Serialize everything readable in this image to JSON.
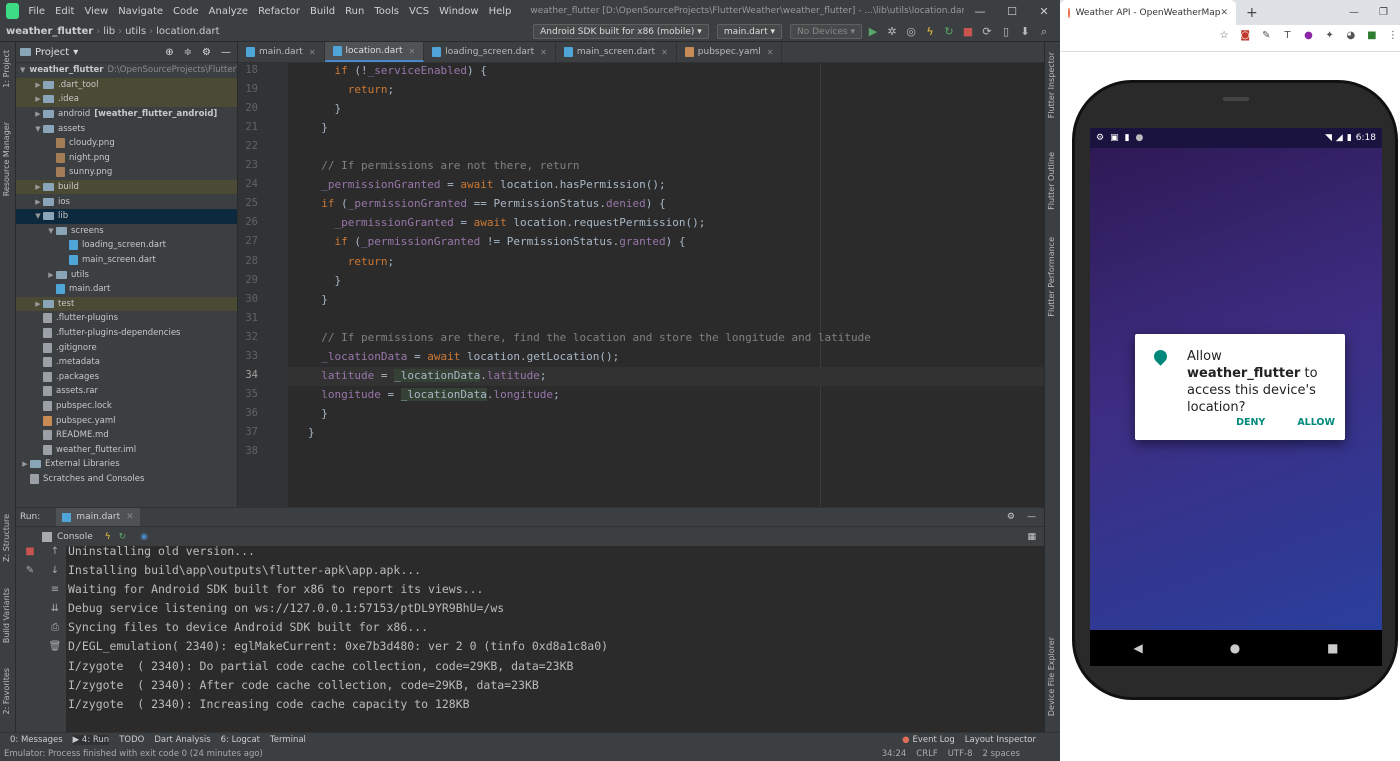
{
  "ide": {
    "menus": [
      "File",
      "Edit",
      "View",
      "Navigate",
      "Code",
      "Analyze",
      "Refactor",
      "Build",
      "Run",
      "Tools",
      "VCS",
      "Window",
      "Help"
    ],
    "window_title": "weather_flutter [D:\\OpenSourceProjects\\FlutterWeather\\weather_flutter] - ...\\lib\\utils\\location.dart [weather_flutter] - Android Studio",
    "breadcrumb": [
      "weather_flutter",
      "lib",
      "utils",
      "location.dart"
    ],
    "device_select": "Android SDK built for x86 (mobile)",
    "config_select": "main.dart",
    "devices_select": "No Devices",
    "project_header": "Project",
    "tree": [
      {
        "label": "weather_flutter",
        "extra": "D:\\OpenSourceProjects\\FlutterW",
        "depth": 0,
        "type": "folder",
        "open": true,
        "bold": true
      },
      {
        "label": ".dart_tool",
        "depth": 1,
        "type": "folder",
        "hl": true
      },
      {
        "label": ".idea",
        "depth": 1,
        "type": "folder",
        "hl": true
      },
      {
        "label": "android",
        "extra": "[weather_flutter_android]",
        "depth": 1,
        "type": "folder"
      },
      {
        "label": "assets",
        "depth": 1,
        "type": "folder",
        "open": true
      },
      {
        "label": "cloudy.png",
        "depth": 2,
        "type": "img"
      },
      {
        "label": "night.png",
        "depth": 2,
        "type": "img"
      },
      {
        "label": "sunny.png",
        "depth": 2,
        "type": "img"
      },
      {
        "label": "build",
        "depth": 1,
        "type": "folder",
        "hl": true
      },
      {
        "label": "ios",
        "depth": 1,
        "type": "folder"
      },
      {
        "label": "lib",
        "depth": 1,
        "type": "folder",
        "open": true,
        "sel": true
      },
      {
        "label": "screens",
        "depth": 2,
        "type": "folder",
        "open": true
      },
      {
        "label": "loading_screen.dart",
        "depth": 3,
        "type": "dart"
      },
      {
        "label": "main_screen.dart",
        "depth": 3,
        "type": "dart"
      },
      {
        "label": "utils",
        "depth": 2,
        "type": "folder"
      },
      {
        "label": "main.dart",
        "depth": 2,
        "type": "dart"
      },
      {
        "label": "test",
        "depth": 1,
        "type": "folder",
        "hl": true
      },
      {
        "label": ".flutter-plugins",
        "depth": 1,
        "type": "txt"
      },
      {
        "label": ".flutter-plugins-dependencies",
        "depth": 1,
        "type": "txt"
      },
      {
        "label": ".gitignore",
        "depth": 1,
        "type": "txt"
      },
      {
        "label": ".metadata",
        "depth": 1,
        "type": "txt"
      },
      {
        "label": ".packages",
        "depth": 1,
        "type": "txt"
      },
      {
        "label": "assets.rar",
        "depth": 1,
        "type": "txt"
      },
      {
        "label": "pubspec.lock",
        "depth": 1,
        "type": "txt"
      },
      {
        "label": "pubspec.yaml",
        "depth": 1,
        "type": "yaml"
      },
      {
        "label": "README.md",
        "depth": 1,
        "type": "txt"
      },
      {
        "label": "weather_flutter.iml",
        "depth": 1,
        "type": "txt"
      },
      {
        "label": "External Libraries",
        "depth": 0,
        "type": "folder"
      },
      {
        "label": "Scratches and Consoles",
        "depth": 0,
        "type": "txt"
      }
    ],
    "tabs": [
      "main.dart",
      "location.dart",
      "loading_screen.dart",
      "main_screen.dart",
      "pubspec.yaml"
    ],
    "active_tab": 1,
    "code_lines": [
      {
        "n": "18",
        "segs": [
          [
            "    ",
            ""
          ],
          [
            "if",
            "kw"
          ],
          [
            " (!",
            ""
          ],
          [
            "_serviceEnabled",
            "fld"
          ],
          [
            ") {",
            ""
          ]
        ]
      },
      {
        "n": "19",
        "segs": [
          [
            "      ",
            ""
          ],
          [
            "return",
            "kw"
          ],
          [
            ";",
            ""
          ]
        ]
      },
      {
        "n": "20",
        "segs": [
          [
            "    }",
            ""
          ]
        ]
      },
      {
        "n": "21",
        "segs": [
          [
            "  }",
            ""
          ]
        ]
      },
      {
        "n": "22",
        "segs": [
          [
            "",
            ""
          ]
        ]
      },
      {
        "n": "23",
        "segs": [
          [
            "  // If permissions are not there, return",
            "cm"
          ]
        ]
      },
      {
        "n": "24",
        "segs": [
          [
            "  ",
            ""
          ],
          [
            "_permissionGranted",
            "fld"
          ],
          [
            " = ",
            ""
          ],
          [
            "await",
            "kw"
          ],
          [
            " location.hasPermission();",
            ""
          ]
        ]
      },
      {
        "n": "25",
        "segs": [
          [
            "  ",
            ""
          ],
          [
            "if",
            "kw"
          ],
          [
            " (",
            ""
          ],
          [
            "_permissionGranted",
            "fld"
          ],
          [
            " == PermissionStatus.",
            ""
          ],
          [
            "denied",
            "fld"
          ],
          [
            ") {",
            ""
          ]
        ]
      },
      {
        "n": "26",
        "segs": [
          [
            "    ",
            ""
          ],
          [
            "_permissionGranted",
            "fld"
          ],
          [
            " = ",
            ""
          ],
          [
            "await",
            "kw"
          ],
          [
            " location.requestPermission();",
            ""
          ]
        ]
      },
      {
        "n": "27",
        "segs": [
          [
            "    ",
            ""
          ],
          [
            "if",
            "kw"
          ],
          [
            " (",
            ""
          ],
          [
            "_permissionGranted",
            "fld"
          ],
          [
            " != PermissionStatus.",
            ""
          ],
          [
            "granted",
            "fld"
          ],
          [
            ") {",
            ""
          ]
        ]
      },
      {
        "n": "28",
        "segs": [
          [
            "      ",
            ""
          ],
          [
            "return",
            "kw"
          ],
          [
            ";",
            ""
          ]
        ]
      },
      {
        "n": "29",
        "segs": [
          [
            "    }",
            ""
          ]
        ]
      },
      {
        "n": "30",
        "segs": [
          [
            "  }",
            ""
          ]
        ]
      },
      {
        "n": "31",
        "segs": [
          [
            "",
            ""
          ]
        ]
      },
      {
        "n": "32",
        "segs": [
          [
            "  // If permissions are there, find the location and store the longitude and latitude",
            "cm"
          ]
        ]
      },
      {
        "n": "33",
        "segs": [
          [
            "  ",
            ""
          ],
          [
            "_locationData",
            "fld"
          ],
          [
            " = ",
            ""
          ],
          [
            "await",
            "kw"
          ],
          [
            " location.getLocation();",
            ""
          ]
        ]
      },
      {
        "n": "34",
        "segs": [
          [
            "  ",
            ""
          ],
          [
            "latitude",
            "fld"
          ],
          [
            " = ",
            ""
          ],
          [
            "_locationData",
            "hl-var"
          ],
          [
            ".",
            ""
          ],
          [
            "latitude",
            "fld"
          ],
          [
            ";",
            ""
          ]
        ],
        "current": true
      },
      {
        "n": "35",
        "segs": [
          [
            "  ",
            ""
          ],
          [
            "longitude",
            "fld"
          ],
          [
            " = ",
            ""
          ],
          [
            "_locationData",
            "hl-var"
          ],
          [
            ".",
            ""
          ],
          [
            "longitude",
            "fld"
          ],
          [
            ";",
            ""
          ]
        ]
      },
      {
        "n": "36",
        "segs": [
          [
            "  }",
            ""
          ]
        ]
      },
      {
        "n": "37",
        "segs": [
          [
            "}",
            ""
          ]
        ]
      },
      {
        "n": "38",
        "segs": [
          [
            "",
            ""
          ]
        ]
      }
    ],
    "left_stripe": [
      "1: Project",
      "Resource Manager",
      "Z: Structure",
      "Build Variants",
      "2: Favorites"
    ],
    "right_stripe": [
      "Flutter Inspector",
      "Flutter Outline",
      "Flutter Performance",
      "Device File Explorer"
    ],
    "run_label": "Run:",
    "run_config": "main.dart",
    "console_tab": "Console",
    "console_lines": [
      "Uninstalling old version...",
      "Installing build\\app\\outputs\\flutter-apk\\app.apk...",
      "Waiting for Android SDK built for x86 to report its views...",
      "Debug service listening on ws://127.0.0.1:57153/ptDL9YR9BhU=/ws",
      "Syncing files to device Android SDK built for x86...",
      "D/EGL_emulation( 2340): eglMakeCurrent: 0xe7b3d480: ver 2 0 (tinfo 0xd8a1c8a0)",
      "I/zygote  ( 2340): Do partial code cache collection, code=29KB, data=23KB",
      "I/zygote  ( 2340): After code cache collection, code=29KB, data=23KB",
      "I/zygote  ( 2340): Increasing code cache capacity to 128KB"
    ],
    "bottom_tools": [
      "0: Messages",
      "4: Run",
      "TODO",
      "Dart Analysis",
      "6: Logcat",
      "Terminal"
    ],
    "bottom_right_tools": [
      "Event Log",
      "Layout Inspector"
    ],
    "status_message": "Emulator: Process finished with exit code 0 (24 minutes ago)",
    "status_right": [
      "34:24",
      "CRLF",
      "UTF-8",
      "2 spaces"
    ]
  },
  "browser": {
    "tab_title": "Weather API - OpenWeatherMap",
    "new_tab": "+"
  },
  "phone": {
    "time": "6:18",
    "dialog_prefix": "Allow ",
    "dialog_app": "weather_flutter",
    "dialog_suffix": " to access this device's location?",
    "deny": "DENY",
    "allow": "ALLOW"
  },
  "colors": {
    "keyword": "#cc7832",
    "comment": "#808080",
    "field": "#9876aa",
    "accent": "#00897b"
  }
}
